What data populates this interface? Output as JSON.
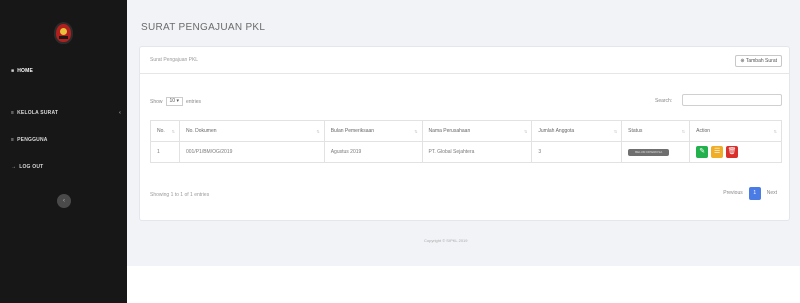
{
  "sidebar": {
    "items": [
      {
        "label": "HOME",
        "icon": "home-icon",
        "glyph": "■"
      },
      {
        "label": "KELOLA SURAT",
        "icon": "list-icon",
        "glyph": "≡",
        "chevron": "‹"
      },
      {
        "label": "PENGGUNA",
        "icon": "users-icon",
        "glyph": "≡"
      },
      {
        "label": "LOG OUT",
        "icon": "logout-icon",
        "glyph": "→"
      }
    ],
    "toggle_glyph": "‹"
  },
  "page": {
    "title": "SURAT PENGAJUAN PKL"
  },
  "card": {
    "title": "Surat Pengajuan PKL",
    "add_button": "⊕ Tambah Surat"
  },
  "table_controls": {
    "show_label": "Show",
    "length_value": "10 ▾",
    "entries_label": "entries",
    "search_label": "Search:",
    "search_value": ""
  },
  "table": {
    "columns": [
      "No.",
      "No. Dokumen",
      "Bulan Pemeriksaan",
      "Nama Perusahaan",
      "Jumlah Anggota",
      "Status",
      "Action"
    ],
    "sort_glyph": "⇅",
    "rows": [
      {
        "no": "1",
        "no_dokumen": "001/P1/BM/OG/2019",
        "bulan": "Agustus 2019",
        "perusahaan": "PT. Global Sejahtera",
        "jumlah": "3",
        "status": "BELUM DIPERIKSA"
      }
    ],
    "action_glyphs": {
      "edit": "✎",
      "view": "☰",
      "delete": "🗑"
    }
  },
  "pagination": {
    "info": "Showing 1 to 1 of 1 entries",
    "previous": "Previous",
    "current": "1",
    "next": "Next"
  },
  "footer": {
    "copyright": "Copyright © SIPKL 2019"
  },
  "colors": {
    "sidebar_bg": "#171717",
    "edit": "#23b14d",
    "view": "#f0ad26",
    "delete": "#d9302c",
    "page_active": "#4b7be5",
    "status": "#6f6f6f"
  }
}
